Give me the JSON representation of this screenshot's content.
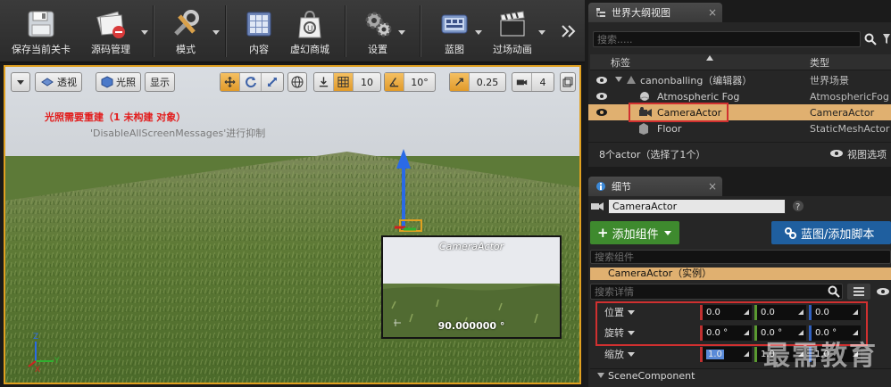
{
  "toolbar": {
    "save_label": "保存当前关卡",
    "source_control_label": "源码管理",
    "modes_label": "模式",
    "content_label": "内容",
    "marketplace_label": "虚幻商城",
    "settings_label": "设置",
    "blueprints_label": "蓝图",
    "cinematics_label": "过场动画",
    "overflow_icon": "double-chevron-right-icon"
  },
  "viewport": {
    "menu_icon": "chevron-down-icon",
    "perspective_label": "透视",
    "lit_label": "光照",
    "show_label": "显示",
    "grid_snap_value": "10",
    "rotation_snap_value": "10°",
    "scale_snap_value": "0.25",
    "camera_speed_value": "4",
    "warning_text": "光照需要重建（1 未构建 对象）",
    "suppress_text": "'DisableAllScreenMessages'进行抑制",
    "preview_title": "CameraActor",
    "preview_fov": "90.000000 °",
    "axis_x": "X",
    "axis_y": "Y",
    "axis_z": "Z",
    "colors": {
      "selection_border": "#e0a020",
      "warning": "#e21d1d"
    }
  },
  "outliner": {
    "tab_label": "世界大纲视图",
    "search_placeholder": "搜索.....",
    "col_label": "标签",
    "col_type": "类型",
    "rows": [
      {
        "name": "canonballing（编辑器）",
        "type": "世界场景"
      },
      {
        "name": "Atmospheric Fog",
        "type": "AtmosphericFog"
      },
      {
        "name": "CameraActor",
        "type": "CameraActor"
      },
      {
        "name": "Floor",
        "type": "StaticMeshActor"
      }
    ],
    "status": "8个actor（选择了1个）",
    "view_options": "视图选项"
  },
  "details": {
    "tab_label": "细节",
    "actor_name": "CameraActor",
    "add_component_label": "添加组件",
    "blueprint_label": "蓝图/添加脚本",
    "search_components_placeholder": "搜索组件",
    "instance_label": "CameraActor（实例）",
    "search_details_placeholder": "搜索详情",
    "location_label": "位置",
    "rotation_label": "旋转",
    "scale_label": "缩放",
    "location": [
      "0.0",
      "0.0",
      "0.0"
    ],
    "rotation": [
      "0.0 °",
      "0.0 °",
      "0.0 °"
    ],
    "scale": [
      "1.0",
      "1.0",
      "1.0"
    ],
    "scene_component_label": "SceneComponent",
    "watermark": "最需教育",
    "colors": {
      "x_axis": "#c03030",
      "y_axis": "#5a9a30",
      "z_axis": "#3060c0",
      "add_button": "#3e8a2e",
      "blueprint_button": "#1f5f9f"
    }
  }
}
